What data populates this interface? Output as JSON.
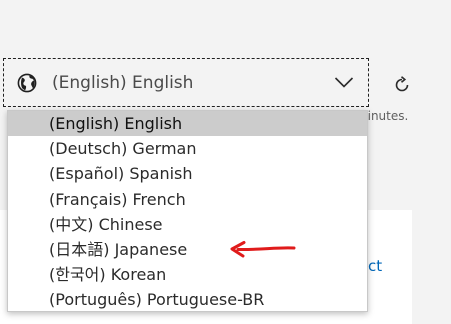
{
  "language_select": {
    "value": "(English) English",
    "icon": "globe-icon",
    "chevron_icon": "chevron-down-icon",
    "options": [
      {
        "label": "(English) English",
        "selected": true
      },
      {
        "label": "(Deutsch) German",
        "selected": false
      },
      {
        "label": "(Español) Spanish",
        "selected": false
      },
      {
        "label": "(Français) French",
        "selected": false
      },
      {
        "label": "(中文) Chinese",
        "selected": false
      },
      {
        "label": "(日本語) Japanese",
        "selected": false
      },
      {
        "label": "(한국어) Korean",
        "selected": false
      },
      {
        "label": "(Português) Portuguese-BR",
        "selected": false
      }
    ]
  },
  "background": {
    "minutes_text": "ninutes.",
    "link_text": "ct",
    "refresh_icon": "refresh-icon"
  },
  "annotation": {
    "icon": "red-arrow-annotation",
    "color": "#e01b1b"
  },
  "colors": {
    "selected_option_bg": "#cccccc",
    "link": "#0067b8",
    "page_bg": "#f3f3f3"
  }
}
